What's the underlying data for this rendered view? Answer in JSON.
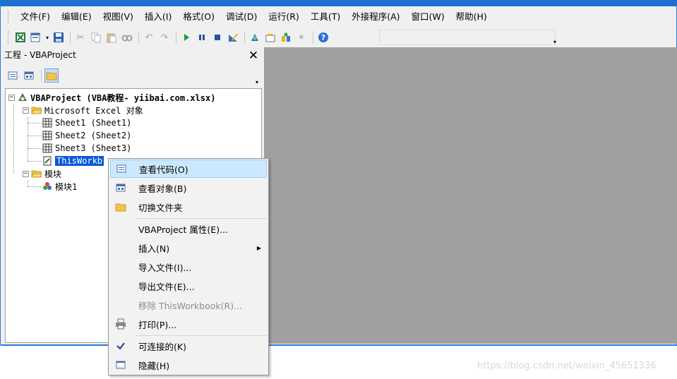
{
  "menubar": {
    "items": [
      "文件(F)",
      "编辑(E)",
      "视图(V)",
      "插入(I)",
      "格式(O)",
      "调试(D)",
      "运行(R)",
      "工具(T)",
      "外接程序(A)",
      "窗口(W)",
      "帮助(H)"
    ]
  },
  "toolbar": {
    "icons": [
      "excel-icon",
      "insert-form-icon",
      "save-icon",
      "cut-icon",
      "copy-icon",
      "paste-icon",
      "find-icon",
      "undo-icon",
      "redo-icon",
      "run-icon",
      "break-icon",
      "reset-icon",
      "design-mode-icon",
      "project-explorer-icon",
      "properties-icon",
      "object-browser-icon",
      "toolbox-icon",
      "help-icon"
    ]
  },
  "panel": {
    "title": "工程 - VBAProject",
    "close": "✕"
  },
  "tree": {
    "root": "VBAProject (VBA教程- yiibai.com.xlsx)",
    "excel_objects": "Microsoft Excel 对象",
    "sheet1": "Sheet1 (Sheet1)",
    "sheet2": "Sheet2 (Sheet2)",
    "sheet3": "Sheet3 (Sheet3)",
    "thisworkbook": "ThisWorkb",
    "modules": "模块",
    "module1": "模块1"
  },
  "context_menu": {
    "view_code": "查看代码(O)",
    "view_object": "查看对象(B)",
    "toggle_folders": "切换文件夹",
    "properties": "VBAProject 属性(E)...",
    "insert": "插入(N)",
    "import_file": "导入文件(I)...",
    "export_file": "导出文件(E)...",
    "remove": "移除 ThisWorkbook(R)...",
    "print": "打印(P)...",
    "dockable": "可连接的(K)",
    "hide": "隐藏(H)"
  },
  "watermark": "https://blog.csdn.net/weixin_45651336"
}
